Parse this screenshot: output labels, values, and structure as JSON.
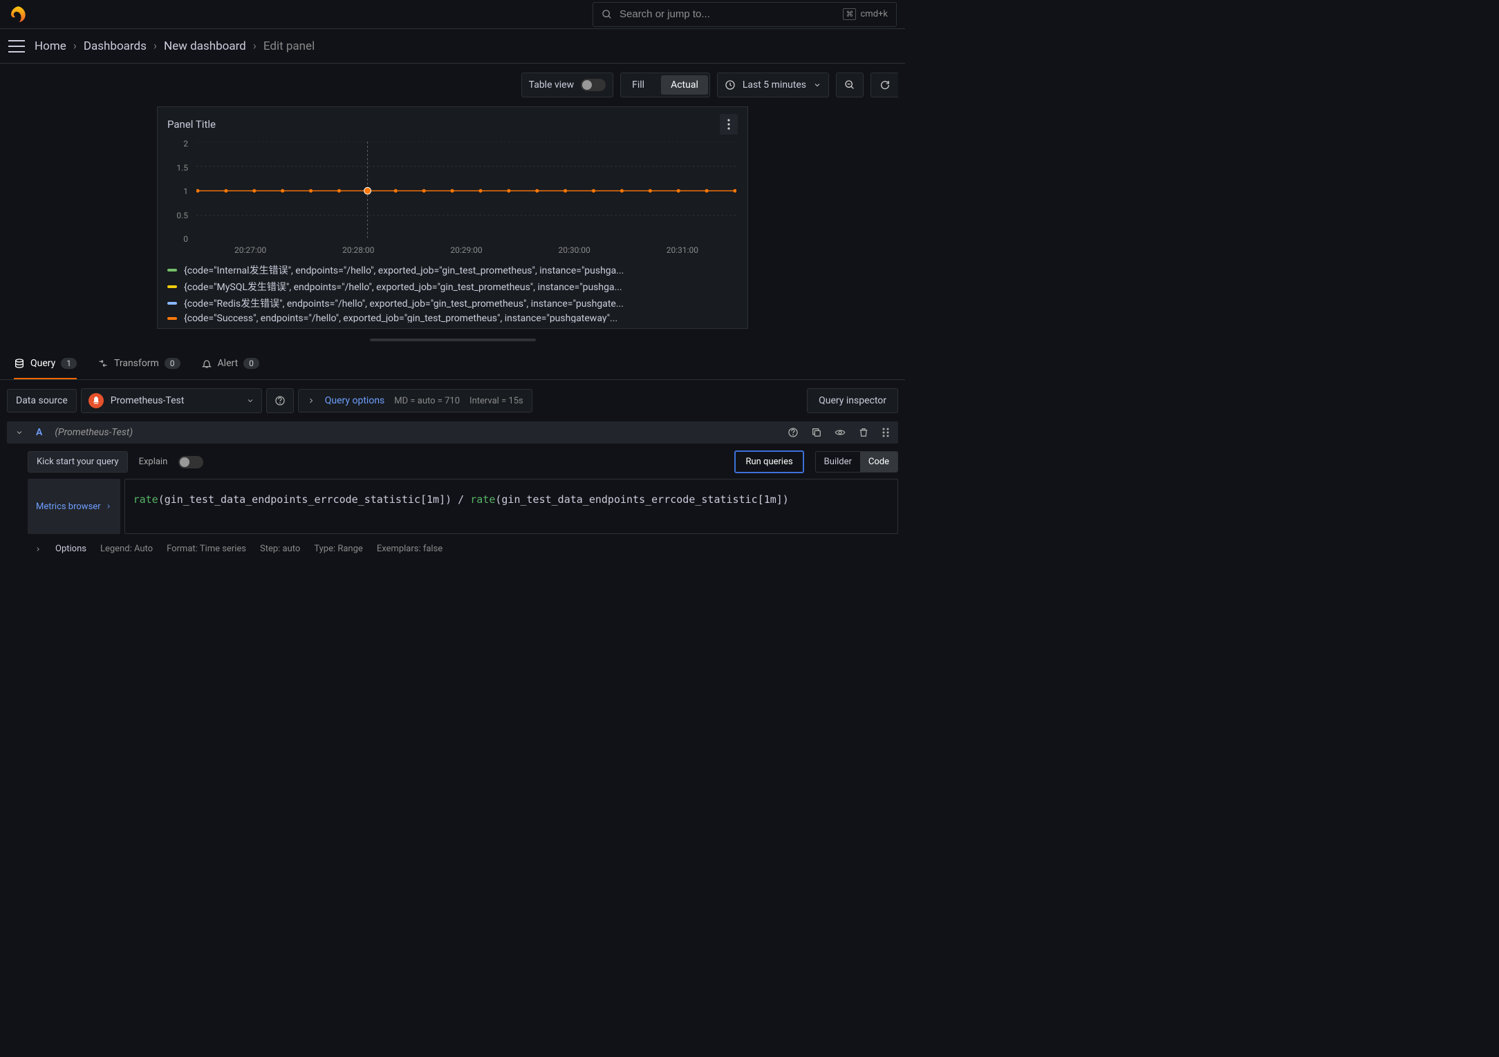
{
  "search": {
    "placeholder": "Search or jump to...",
    "shortcut": "cmd+k"
  },
  "breadcrumb": {
    "items": [
      "Home",
      "Dashboards",
      "New dashboard"
    ],
    "current": "Edit panel"
  },
  "toolbar": {
    "table_view": "Table view",
    "fill": "Fill",
    "actual": "Actual",
    "time_range": "Last 5 minutes"
  },
  "panel": {
    "title": "Panel Title"
  },
  "chart_data": {
    "type": "line",
    "ylim": [
      0,
      2
    ],
    "yticks": [
      "2",
      "1.5",
      "1",
      "0.5",
      "0"
    ],
    "xticks": [
      "20:27:00",
      "20:28:00",
      "20:29:00",
      "20:30:00",
      "20:31:00"
    ],
    "crosshair_x_frac": 0.317,
    "series": [
      {
        "name": "{code=\"Internal发生错误\", endpoints=\"/hello\", exported_job=\"gin_test_prometheus\", instance=\"pushga...",
        "color": "#73bf69",
        "value": 1
      },
      {
        "name": "{code=\"MySQL发生错误\", endpoints=\"/hello\", exported_job=\"gin_test_prometheus\", instance=\"pushga...",
        "color": "#f2cc0c",
        "value": 1
      },
      {
        "name": "{code=\"Redis发生错误\", endpoints=\"/hello\", exported_job=\"gin_test_prometheus\", instance=\"pushgate...",
        "color": "#8ab8ff",
        "value": 1
      },
      {
        "name": "{code=\"Success\", endpoints=\"/hello\", exported_job=\"gin_test_prometheus\", instance=\"pushgateway\"...",
        "color": "#ff780a",
        "value": 1
      }
    ],
    "points_count": 20
  },
  "tabs": {
    "query": {
      "label": "Query",
      "count": "1"
    },
    "transform": {
      "label": "Transform",
      "count": "0"
    },
    "alert": {
      "label": "Alert",
      "count": "0"
    }
  },
  "datasource": {
    "label": "Data source",
    "name": "Prometheus-Test",
    "query_options": "Query options",
    "md": "MD = auto = 710",
    "interval": "Interval = 15s",
    "inspector": "Query inspector"
  },
  "query": {
    "letter": "A",
    "dsname": "(Prometheus-Test)",
    "kick": "Kick start your query",
    "explain": "Explain",
    "run": "Run queries",
    "builder": "Builder",
    "code": "Code",
    "metrics_browser": "Metrics browser",
    "expr_display": "rate(gin_test_data_endpoints_errcode_statistic[1m]) / rate(gin_test_data_endpoints_errcode_statistic[1m])"
  },
  "options": {
    "label": "Options",
    "legend": "Legend: Auto",
    "format": "Format: Time series",
    "step": "Step: auto",
    "type": "Type: Range",
    "exemplars": "Exemplars: false"
  }
}
